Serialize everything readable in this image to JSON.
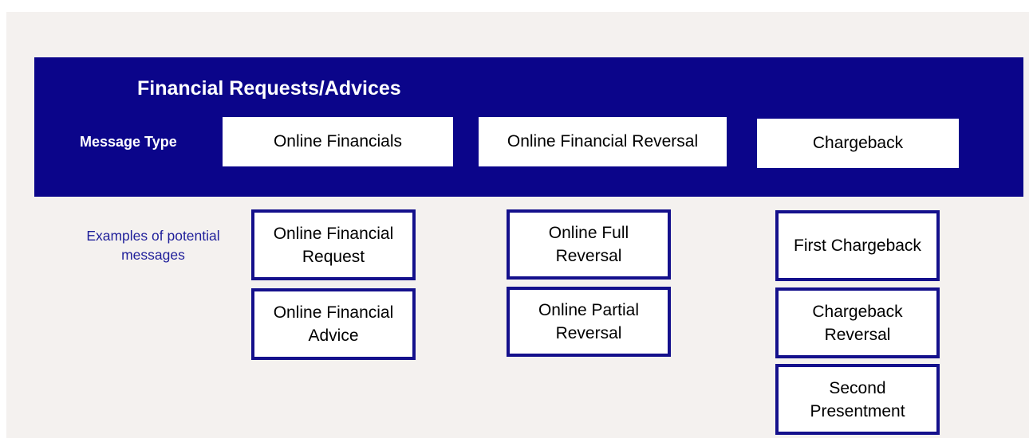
{
  "diagram": {
    "title": "Financial Requests/Advices",
    "row_label": "Message Type",
    "examples_label": "Examples of potential messages",
    "message_types": [
      {
        "label": "Online Financials",
        "examples": [
          "Online Financial Request",
          "Online Financial Advice"
        ]
      },
      {
        "label": "Online Financial Reversal",
        "examples": [
          "Online Full Reversal",
          "Online Partial Reversal"
        ]
      },
      {
        "label": "Chargeback",
        "examples": [
          "First Chargeback",
          "Chargeback Reversal",
          "Second Presentment"
        ]
      }
    ]
  },
  "colors": {
    "banner": "#0b058a",
    "box_border": "#14108c",
    "examples_text": "#1f1f9a",
    "background": "#f4f1ef"
  }
}
